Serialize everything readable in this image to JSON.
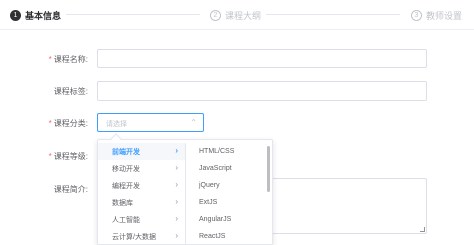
{
  "steps": [
    {
      "number": "1",
      "label": "基本信息",
      "state": "active"
    },
    {
      "number": "2",
      "label": "课程大纲",
      "state": "inactive"
    },
    {
      "number": "3",
      "label": "教师设置",
      "state": "inactive"
    }
  ],
  "form": {
    "course_name_label": "课程名称:",
    "course_tag_label": "课程标签:",
    "course_category_label": "课程分类:",
    "course_category_placeholder": "请选择",
    "course_level_label": "课程等级:",
    "course_intro_label": "课程简介:",
    "required_mark": "*"
  },
  "cascader": {
    "level1": [
      {
        "label": "前端开发",
        "active": true
      },
      {
        "label": "移动开发",
        "active": false
      },
      {
        "label": "编程开发",
        "active": false
      },
      {
        "label": "数据库",
        "active": false
      },
      {
        "label": "人工智能",
        "active": false
      },
      {
        "label": "云计算/大数据",
        "active": false
      }
    ],
    "level2": [
      "HTML/CSS",
      "JavaScript",
      "jQuery",
      "ExtJS",
      "AngularJS",
      "ReactJS"
    ],
    "chevron_icon": "chevron-right-icon"
  },
  "colors": {
    "primary": "#409eff",
    "required": "#f56c6c",
    "active_step": "#303133",
    "inactive_step": "#c0c4cc"
  }
}
